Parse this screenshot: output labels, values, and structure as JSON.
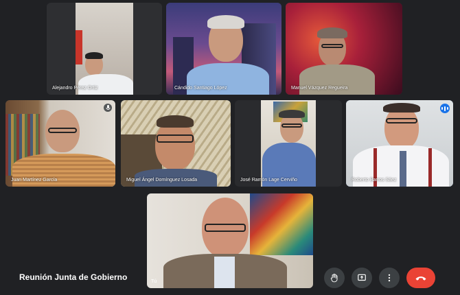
{
  "meeting": {
    "title": "Reunión Junta de Gobierno"
  },
  "participants": [
    {
      "name": "Alejandro Pérez Ortiz"
    },
    {
      "name": "Cándido Santiago López"
    },
    {
      "name": "Manuel Vázquez Regueira"
    },
    {
      "name": "Juan Martínez García"
    },
    {
      "name": "Miguel Ángel Domínguez Losada"
    },
    {
      "name": "José Ramón Lage Cerviño"
    },
    {
      "name": "Roberto Barros Sáez"
    }
  ],
  "self_view": {
    "label": "Tú"
  },
  "controls": {
    "raise_hand": "hand-icon",
    "present": "present-screen-icon",
    "more": "more-vert-icon",
    "end_call": "call-end-icon"
  },
  "colors": {
    "background": "#202124",
    "end_call": "#ea4335",
    "speaking": "#1a73e8"
  }
}
